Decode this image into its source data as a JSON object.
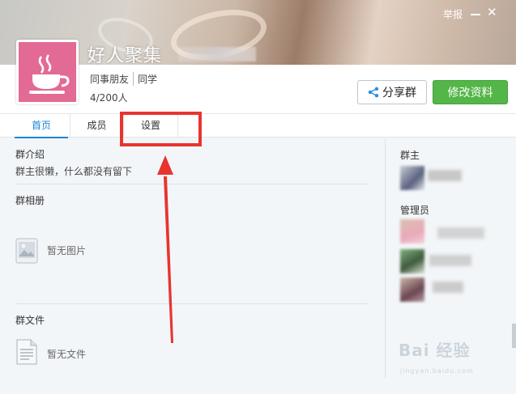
{
  "header": {
    "group_name": "好人聚集",
    "report_label": "举报",
    "tags": [
      "同事朋友",
      "同学"
    ],
    "member_count": "4/200人",
    "share_label": "分享群",
    "edit_label": "修改资料"
  },
  "tabs": [
    {
      "label": "首页",
      "active": true
    },
    {
      "label": "成员",
      "active": false
    },
    {
      "label": "设置",
      "active": false
    }
  ],
  "intro": {
    "title": "群介绍",
    "text": "群主很懒，什么都没有留下"
  },
  "album": {
    "title": "群相册",
    "empty_label": "暂无图片"
  },
  "files": {
    "title": "群文件",
    "empty_label": "暂无文件"
  },
  "sidebar": {
    "owner_title": "群主",
    "admin_title": "管理员"
  },
  "watermark": {
    "brand": "Bai 经验",
    "url": "jingyan.baidu.com"
  },
  "colors": {
    "accent": "#1a86d6",
    "primary_button": "#54b548",
    "highlight": "#e8342f",
    "avatar_bg": "#e36a94"
  },
  "icons": {
    "avatar": "teacup-icon",
    "share": "share-icon",
    "album": "image-placeholder-icon",
    "files": "document-icon"
  }
}
